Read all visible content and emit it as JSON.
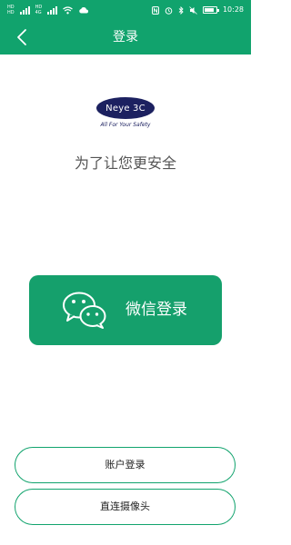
{
  "status_bar": {
    "time": "10:28",
    "left_icons": [
      "signal-icon",
      "signal-icon",
      "wifi-icon",
      "cloud-icon"
    ],
    "right_icons": [
      "nfc-icon",
      "alarm-icon",
      "bluetooth-icon",
      "mute-icon",
      "battery-icon"
    ]
  },
  "header": {
    "title": "登录",
    "back_icon": "chevron-left-icon"
  },
  "logo": {
    "brand": "Neye 3C",
    "tagline": "All For Your Safety"
  },
  "subtitle": "为了让您更安全",
  "wechat_login": {
    "label": "微信登录",
    "icon": "wechat-icon"
  },
  "buttons": {
    "account_login": "账户登录",
    "direct_camera": "直连摄像头"
  },
  "colors": {
    "primary": "#11a36d",
    "brand_navy": "#1c2160"
  }
}
